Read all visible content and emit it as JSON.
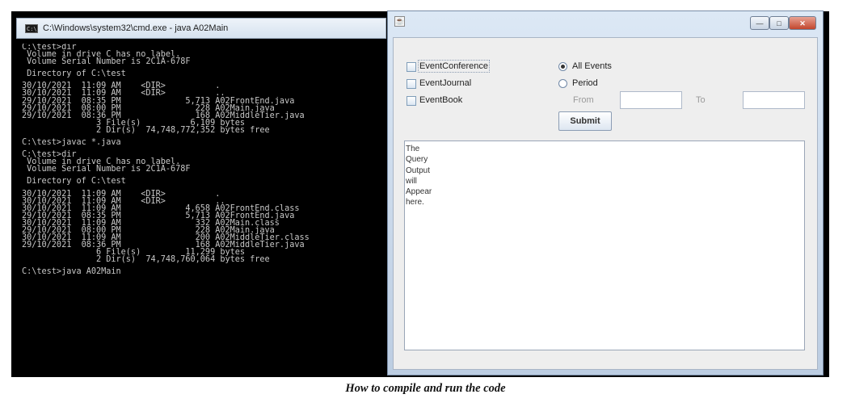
{
  "cmd_window": {
    "title": "C:\\Windows\\system32\\cmd.exe - java  A02Main",
    "lines": [
      "C:\\test>dir",
      " Volume in drive C has no label.",
      " Volume Serial Number is 2C1A-678F",
      "",
      " Directory of C:\\test",
      "",
      "30/10/2021  11:09 AM    <DIR>          .",
      "30/10/2021  11:09 AM    <DIR>          ..",
      "29/10/2021  08:35 PM             5,713 A02FrontEnd.java",
      "29/10/2021  08:00 PM               228 A02Main.java",
      "29/10/2021  08:36 PM               168 A02MiddleTier.java",
      "               3 File(s)          6,109 bytes",
      "               2 Dir(s)  74,748,772,352 bytes free",
      "",
      "C:\\test>javac *.java",
      "",
      "C:\\test>dir",
      " Volume in drive C has no label.",
      " Volume Serial Number is 2C1A-678F",
      "",
      " Directory of C:\\test",
      "",
      "30/10/2021  11:09 AM    <DIR>          .",
      "30/10/2021  11:09 AM    <DIR>          ..",
      "30/10/2021  11:09 AM             4,658 A02FrontEnd.class",
      "29/10/2021  08:35 PM             5,713 A02FrontEnd.java",
      "30/10/2021  11:09 AM               332 A02Main.class",
      "29/10/2021  08:00 PM               228 A02Main.java",
      "30/10/2021  11:09 AM               200 A02MiddleTier.class",
      "29/10/2021  08:36 PM               168 A02MiddleTier.java",
      "               6 File(s)         11,299 bytes",
      "               2 Dir(s)  74,748,760,064 bytes free",
      "",
      "C:\\test>java A02Main"
    ]
  },
  "java_window": {
    "icon": "java-icon",
    "buttons": {
      "minimize": "—",
      "maximize": "□",
      "close": "✕"
    },
    "checkboxes": [
      {
        "label": "EventConference",
        "checked": false
      },
      {
        "label": "EventJournal",
        "checked": false
      },
      {
        "label": "EventBook",
        "checked": false
      }
    ],
    "radios": [
      {
        "label": "All Events",
        "selected": true
      },
      {
        "label": "Period",
        "selected": false
      }
    ],
    "range": {
      "from_label": "From",
      "to_label": "To",
      "from_value": "",
      "to_value": ""
    },
    "submit_label": "Submit",
    "output_text": "The\nQuery\nOutput\nwill\nAppear\nhere."
  },
  "caption": "How to compile and run the code",
  "colors": {
    "console_bg": "#000000",
    "console_text": "#c8c8c8",
    "titlebar": "#d6e2ef",
    "close_button": "#c2462d"
  }
}
